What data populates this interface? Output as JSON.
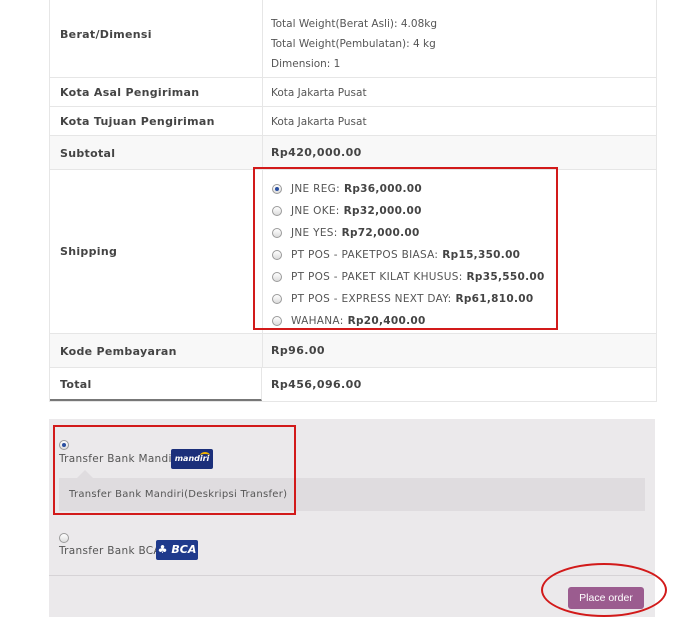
{
  "order_table": {
    "weight": {
      "label": "Berat/Dimensi",
      "lines": [
        "Total Weight(Berat Asli): 4.08kg",
        "Total Weight(Pembulatan): 4 kg",
        "Dimension: 1"
      ]
    },
    "origin": {
      "label": "Kota Asal Pengiriman",
      "value": "Kota Jakarta Pusat"
    },
    "destination": {
      "label": "Kota Tujuan Pengiriman",
      "value": "Kota Jakarta Pusat"
    },
    "subtotal": {
      "label": "Subtotal",
      "value": "Rp420,000.00"
    },
    "shipping": {
      "label": "Shipping",
      "options": [
        {
          "name": "JNE REG:",
          "price": "Rp36,000.00",
          "selected": true
        },
        {
          "name": "JNE OKE:",
          "price": "Rp32,000.00",
          "selected": false
        },
        {
          "name": "JNE YES:",
          "price": "Rp72,000.00",
          "selected": false
        },
        {
          "name": "PT POS - PAKETPOS BIASA:",
          "price": "Rp15,350.00",
          "selected": false
        },
        {
          "name": "PT POS - PAKET KILAT KHUSUS:",
          "price": "Rp35,550.00",
          "selected": false
        },
        {
          "name": "PT POS - EXPRESS NEXT DAY:",
          "price": "Rp61,810.00",
          "selected": false
        },
        {
          "name": "WAHANA:",
          "price": "Rp20,400.00",
          "selected": false
        }
      ]
    },
    "payment_code": {
      "label": "Kode Pembayaran",
      "value": "Rp96.00"
    },
    "total": {
      "label": "Total",
      "value": "Rp456,096.00"
    }
  },
  "payment": {
    "methods": [
      {
        "label": "Transfer Bank Mandiri",
        "logo": "mandiri",
        "selected": true,
        "description": "Transfer Bank Mandiri(Deskripsi Transfer)"
      },
      {
        "label": "Transfer Bank BCA",
        "logo": "BCA",
        "selected": false
      }
    ],
    "place_order": "Place order"
  },
  "annotation_color": "#d21a1a",
  "button_color": "#9b5c8f"
}
